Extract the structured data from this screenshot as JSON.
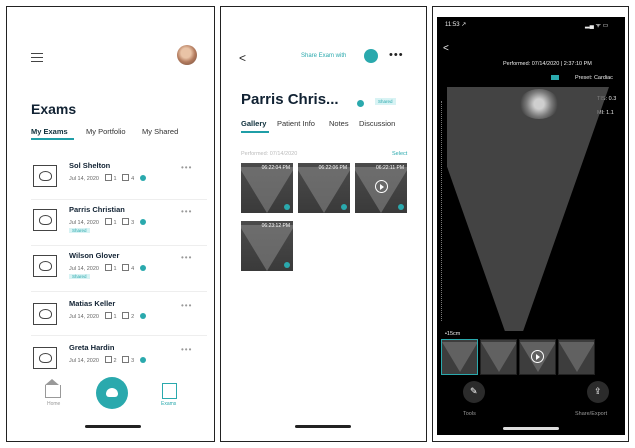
{
  "screen1": {
    "title": "Exams",
    "tabs": [
      "My Exams",
      "My Portfolio",
      "My Shared"
    ],
    "exams": [
      {
        "name": "Sol Shelton",
        "date": "Jul 14, 2020",
        "reports": "1",
        "images": "4",
        "shared": ""
      },
      {
        "name": "Parris Christian",
        "date": "Jul 14, 2020",
        "reports": "1",
        "images": "3",
        "shared": "Shared"
      },
      {
        "name": "Wilson Glover",
        "date": "Jul 14, 2020",
        "reports": "1",
        "images": "4",
        "shared": "Shared"
      },
      {
        "name": "Matias Keller",
        "date": "Jul 14, 2020",
        "reports": "1",
        "images": "2",
        "shared": ""
      },
      {
        "name": "Greta Hardin",
        "date": "Jul 14, 2020",
        "reports": "2",
        "images": "3",
        "shared": ""
      }
    ],
    "nav": {
      "home": "Home",
      "exams": "Exams"
    }
  },
  "screen2": {
    "back": "<",
    "share_label": "Share Exam with",
    "more": "•••",
    "patient_title": "Parris Chris...",
    "shared_badge": "Shared",
    "tabs": [
      "Gallery",
      "Patient Info",
      "Notes",
      "Discussion"
    ],
    "performed": "Performed: 07/14/2020",
    "select": "Select",
    "tiles": [
      {
        "time": "06:22:04 PM",
        "video": false
      },
      {
        "time": "06:22:06 PM",
        "video": false
      },
      {
        "time": "06:22:11 PM",
        "video": true
      },
      {
        "time": "06:23:12 PM",
        "video": false
      }
    ]
  },
  "screen3": {
    "status_time": "11:53 ↗",
    "status_icons": "▂▄ ᯤ ▭",
    "back": "<",
    "performed": "Performed: 07/14/2020 | 2:37:10 PM",
    "preset": "Preset: Cardiac",
    "tis": "TIS: 0.3",
    "mi": "MI: 1.1",
    "depth": "•15cm",
    "tools_label": "Tools",
    "share_export_label": "Share/Export"
  },
  "colors": {
    "accent": "#2aa9ad",
    "dark_text": "#123"
  }
}
